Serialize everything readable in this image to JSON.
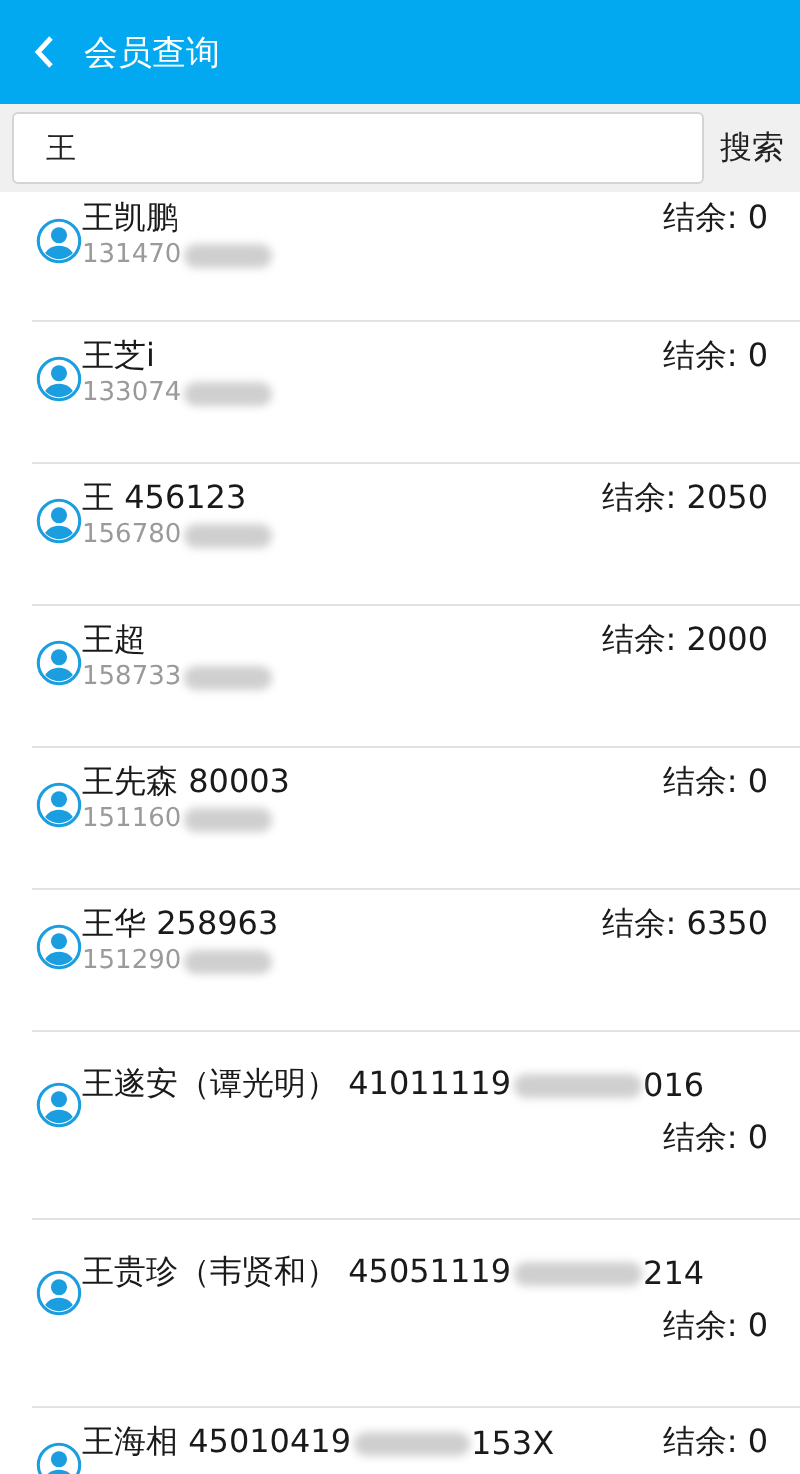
{
  "header": {
    "title": "会员查询"
  },
  "search": {
    "value": "王",
    "button": "搜索"
  },
  "members": [
    {
      "kind": "short",
      "name": "王凯鹏",
      "phone": "131470",
      "balance": "结余: 0"
    },
    {
      "kind": "short",
      "name": "王芝i",
      "phone": "133074",
      "balance": "结余: 0"
    },
    {
      "kind": "short",
      "name": "王 456123",
      "phone": "156780",
      "balance": "结余: 2050"
    },
    {
      "kind": "short",
      "name": "王超",
      "phone": "158733",
      "balance": "结余: 2000"
    },
    {
      "kind": "short",
      "name": "王先森 80003",
      "phone": "151160",
      "balance": "结余: 0"
    },
    {
      "kind": "short",
      "name": "王华 258963",
      "phone": "151290",
      "balance": "结余: 6350"
    },
    {
      "kind": "long",
      "name": "王遂安（谭光明） 41011119",
      "name_end": "016",
      "balance": "结余: 0"
    },
    {
      "kind": "long",
      "name": "王贵珍（韦贤和） 45051119",
      "name_end": "214",
      "balance": "结余: 0"
    },
    {
      "kind": "short",
      "name": "王海相 45010419",
      "name_end": "153X",
      "balance": "结余: 0"
    }
  ]
}
